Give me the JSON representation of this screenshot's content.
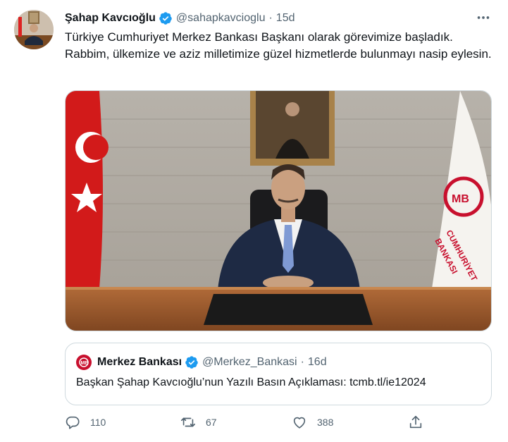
{
  "author": {
    "name": "Şahap Kavcıoğlu",
    "handle": "@sahapkavcioglu",
    "separator": "·",
    "time": "15d"
  },
  "tweet": {
    "text": "Türkiye Cumhuriyet Merkez Bankası Başkanı olarak görevimize başladık. Rabbim, ülkemize ve aziz milletimize güzel hizmetlerde bulunmayı nasip eylesin."
  },
  "media": {
    "banner_text_line1": "CUMHURİYET",
    "banner_text_line2": "BANKASI"
  },
  "quoted": {
    "name": "Merkez Bankası",
    "handle": "@Merkez_Bankasi",
    "separator": "·",
    "time": "16d",
    "text": "Başkan Şahap Kavcıoğlu’nun Yazılı Basın Açıklaması: tcmb.tl/ie12024"
  },
  "actions": {
    "reply_count": "110",
    "retweet_count": "67",
    "like_count": "388"
  },
  "colors": {
    "verified": "#1d9bf0",
    "secondary_text": "#536471",
    "border": "#cfd9de",
    "brand_red": "#c8102e"
  }
}
